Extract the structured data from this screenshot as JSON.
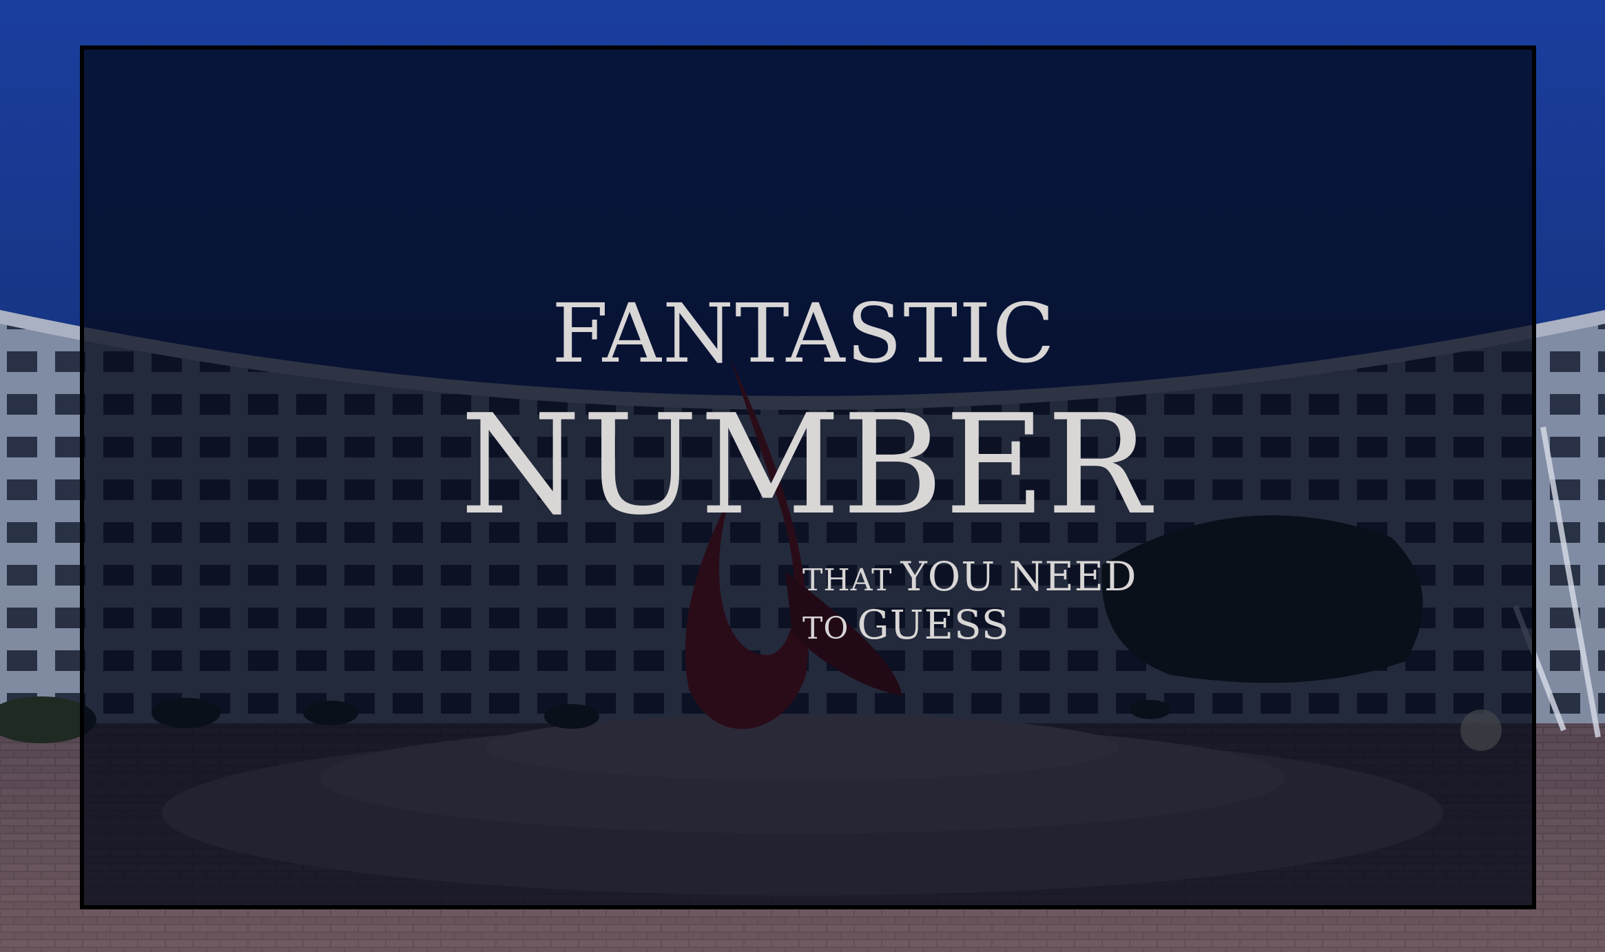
{
  "title": {
    "line1": "FANTASTIC",
    "line2": "NUMBER"
  },
  "subtitle": {
    "line1_small": "THAT",
    "line1_big": "YOU NEED",
    "line2_small": "TO",
    "line2_big": "GUESS"
  },
  "colors": {
    "title_text": "#d9d6d6",
    "overlay": "#030818",
    "sky": "#1b3f9a",
    "sculpture": "#8a1414"
  }
}
